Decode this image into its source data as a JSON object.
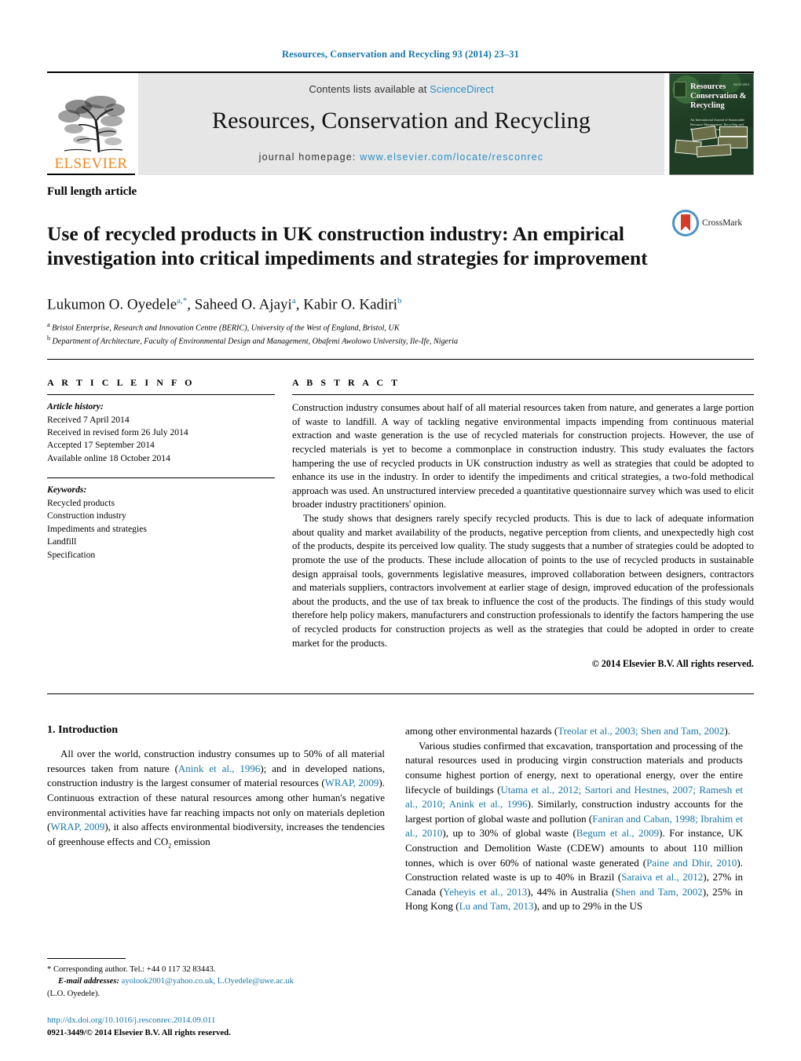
{
  "running_head": "Resources, Conservation and Recycling 93 (2014) 23–31",
  "masthead": {
    "publisher": "ELSEVIER",
    "contents_prefix": "Contents lists available at ",
    "contents_link": "ScienceDirect",
    "journal_title": "Resources, Conservation and Recycling",
    "homepage_prefix": "journal homepage: ",
    "homepage_url": "www.elsevier.com/locate/resconrec",
    "cover_title": "Resources Conservation & Recycling",
    "cover_subtitle": "An International Journal of Sustainable Resource Management, Recycling and Environmental Science",
    "cover_issue": "Vol 93 2014",
    "link_color": "#2b8fc4",
    "brand_color": "#f08a1c",
    "banner_bg": "#e6e6e6"
  },
  "article": {
    "type": "Full length article",
    "title": "Use of recycled products in UK construction industry: An empirical investigation into critical impediments and strategies for improvement",
    "crossmark_label": "CrossMark",
    "authors_html": "Lukumon O. Oyedele<sup>a,*</sup>, Saheed O. Ajayi<sup>a</sup>, Kabir O. Kadiri<sup>b</sup>",
    "affiliations": [
      {
        "marker": "a",
        "text": "Bristol Enterprise, Research and Innovation Centre (BERIC), University of the West of England, Bristol, UK"
      },
      {
        "marker": "b",
        "text": "Department of Architecture, Faculty of Environmental Design and Management, Obafemi Awolowo University, Ile-Ife, Nigeria"
      }
    ]
  },
  "article_info": {
    "heading": "A R T I C L E   I N F O",
    "history_label": "Article history:",
    "history": [
      "Received 7 April 2014",
      "Received in revised form 26 July 2014",
      "Accepted 17 September 2014",
      "Available online 18 October 2014"
    ],
    "keywords_label": "Keywords:",
    "keywords": [
      "Recycled products",
      "Construction industry",
      "Impediments and strategies",
      "Landfill",
      "Specification"
    ]
  },
  "abstract": {
    "heading": "A B S T R A C T",
    "paragraphs": [
      "Construction industry consumes about half of all material resources taken from nature, and generates a large portion of waste to landfill. A way of tackling negative environmental impacts impending from continuous material extraction and waste generation is the use of recycled materials for construction projects. However, the use of recycled materials is yet to become a commonplace in construction industry. This study evaluates the factors hampering the use of recycled products in UK construction industry as well as strategies that could be adopted to enhance its use in the industry. In order to identify the impediments and critical strategies, a two-fold methodical approach was used. An unstructured interview preceded a quantitative questionnaire survey which was used to elicit broader industry practitioners' opinion.",
      "The study shows that designers rarely specify recycled products. This is due to lack of adequate information about quality and market availability of the products, negative perception from clients, and unexpectedly high cost of the products, despite its perceived low quality. The study suggests that a number of strategies could be adopted to promote the use of the products. These include allocation of points to the use of recycled products in sustainable design appraisal tools, governments legislative measures, improved collaboration between designers, contractors and materials suppliers, contractors involvement at earlier stage of design, improved education of the professionals about the products, and the use of tax break to influence the cost of the products. The findings of this study would therefore help policy makers, manufacturers and construction professionals to identify the factors hampering the use of recycled products for construction projects as well as the strategies that could be adopted in order to create market for the products."
    ],
    "copyright": "© 2014 Elsevier B.V. All rights reserved."
  },
  "body": {
    "section_number_title": "1.  Introduction",
    "left_paragraph_html": "All over the world, construction industry consumes up to 50% of all material resources taken from nature (<span class=\"cit\">Anink et al., 1996</span>); and in developed nations, construction industry is the largest consumer of material resources (<span class=\"cit\">WRAP, 2009</span>). Continuous extraction of these natural resources among other human's negative environmental activities have far reaching impacts not only on materials depletion (<span class=\"cit\">WRAP, 2009</span>), it also affects environmental biodiversity, increases the tendencies of greenhouse effects and CO<sub>2</sub> emission",
    "right_paragraph_1_html": "among other environmental hazards (<span class=\"cit\">Treolar et al., 2003; Shen and Tam, 2002</span>).",
    "right_paragraph_2_html": "Various studies confirmed that excavation, transportation and processing of the natural resources used in producing virgin construction materials and products consume highest portion of energy, next to operational energy, over the entire lifecycle of buildings (<span class=\"cit\">Utama et al., 2012; Sartori and Hestnes, 2007; Ramesh et al., 2010; Anink et al., 1996</span>). Similarly, construction industry accounts for the largest portion of global waste and pollution (<span class=\"cit\">Faniran and Caban, 1998; Ibrahim et al., 2010</span>), up to 30% of global waste (<span class=\"cit\">Begum et al., 2009</span>). For instance, UK Construction and Demolition Waste (CDEW) amounts to about 110 million tonnes, which is over 60% of national waste generated (<span class=\"cit\">Paine and Dhir, 2010</span>). Construction related waste is up to 40% in Brazil (<span class=\"cit\">Saraiva et al., 2012</span>), 27% in Canada (<span class=\"cit\">Yeheyis et al., 2013</span>), 44% in Australia (<span class=\"cit\">Shen and Tam, 2002</span>), 25% in Hong Kong (<span class=\"cit\">Lu and Tam, 2013</span>), and up to 29% in the US"
  },
  "footnotes": {
    "corresponding_html": "* Corresponding author. Tel.: +44 0 117 32 83443.",
    "email_label": "E-mail addresses:",
    "emails": "ayolook2001@yahoo.co.uk, L.Oyedele@uwe.ac.uk",
    "email_owner": "(L.O. Oyedele).",
    "doi": "http://dx.doi.org/10.1016/j.resconrec.2014.09.011",
    "issn_line": "0921-3449/© 2014 Elsevier B.V. All rights reserved."
  }
}
